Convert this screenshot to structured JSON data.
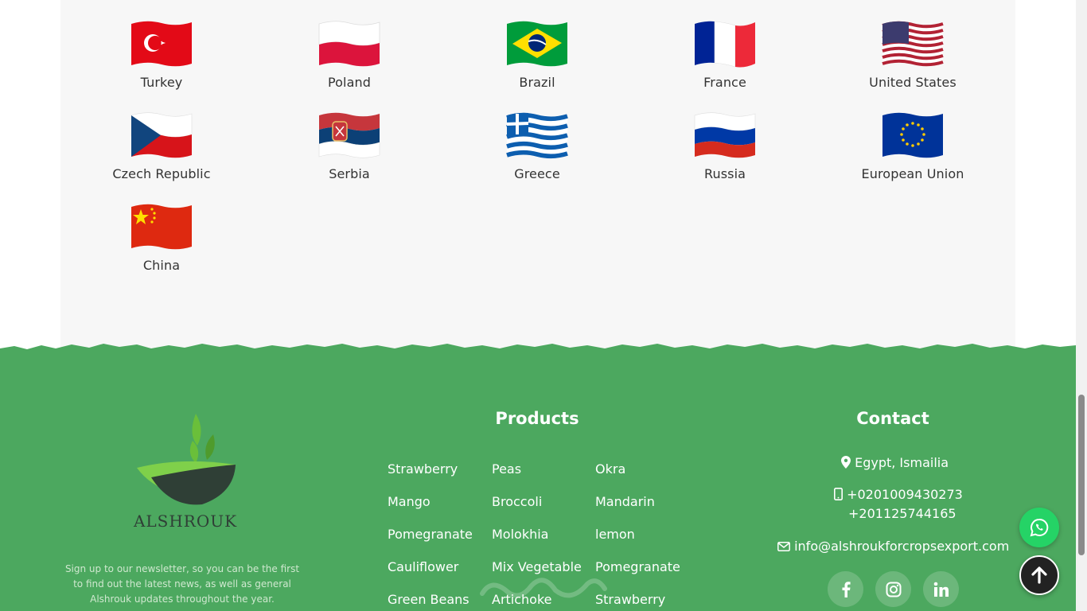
{
  "flags": [
    {
      "name": "Turkey",
      "icon": "turkey-flag-icon"
    },
    {
      "name": "Poland",
      "icon": "poland-flag-icon"
    },
    {
      "name": "Brazil",
      "icon": "brazil-flag-icon"
    },
    {
      "name": "France",
      "icon": "france-flag-icon"
    },
    {
      "name": "United States",
      "icon": "usa-flag-icon"
    },
    {
      "name": "Czech Republic",
      "icon": "czech-flag-icon"
    },
    {
      "name": "Serbia",
      "icon": "serbia-flag-icon"
    },
    {
      "name": "Greece",
      "icon": "greece-flag-icon"
    },
    {
      "name": "Russia",
      "icon": "russia-flag-icon"
    },
    {
      "name": "European Union",
      "icon": "eu-flag-icon"
    },
    {
      "name": "China",
      "icon": "china-flag-icon"
    }
  ],
  "footer": {
    "logo_text": "ALSHROUK",
    "newsletter": "Sign up to our newsletter, so you can be the first to find out the latest news, as well as general Alshrouk updates throughout the year.",
    "products_title": "Products",
    "products": [
      [
        "Strawberry",
        "Mango",
        "Pomegranate",
        "Cauliflower",
        "Green Beans"
      ],
      [
        "Peas",
        "Broccoli",
        "Molokhia",
        "Mix Vegetable",
        "Artichoke"
      ],
      [
        "Okra",
        "Mandarin",
        "lemon",
        "Pomegranate",
        "Strawberry"
      ]
    ],
    "contact_title": "Contact",
    "address": "Egypt, Ismailia",
    "phone_1": "+0201009430273",
    "phone_2": "+201125744165",
    "email": "info@alshroukforcropsexport.com",
    "social": [
      "facebook-icon",
      "instagram-icon",
      "linkedin-icon"
    ]
  },
  "colors": {
    "footer_green": "#4ca85f",
    "whatsapp": "#25d366",
    "panel_bg": "#f7f7f7"
  }
}
